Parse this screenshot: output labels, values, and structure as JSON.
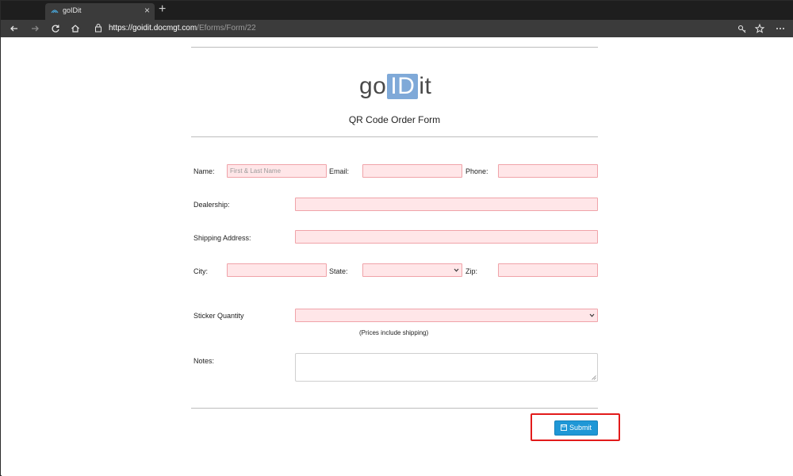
{
  "browser": {
    "tab_title": "goIDit",
    "tab_close": "×",
    "new_tab": "+",
    "url_scheme": "https://",
    "url_host": "goidit.docmgt.com",
    "url_path": "/Eforms/Form/22"
  },
  "logo": {
    "part1": "go",
    "part2": "ID",
    "part3": "it"
  },
  "form": {
    "title": "QR Code Order Form",
    "name_label": "Name:",
    "name_placeholder": "First & Last Name",
    "email_label": "Email:",
    "phone_label": "Phone:",
    "dealership_label": "Dealership:",
    "shipping_label": "Shipping Address:",
    "city_label": "City:",
    "state_label": "State:",
    "zip_label": "Zip:",
    "sticker_label": "Sticker Quantity",
    "prices_note": "(Prices include shipping)",
    "notes_label": "Notes:",
    "submit_label": "Submit"
  },
  "colors": {
    "field_bg": "#ffe6e8",
    "field_border": "#f0a3a9",
    "submit_bg": "#1f97d6",
    "logo_id_bg": "#7fa9d8",
    "highlight": "#e21b1b"
  }
}
